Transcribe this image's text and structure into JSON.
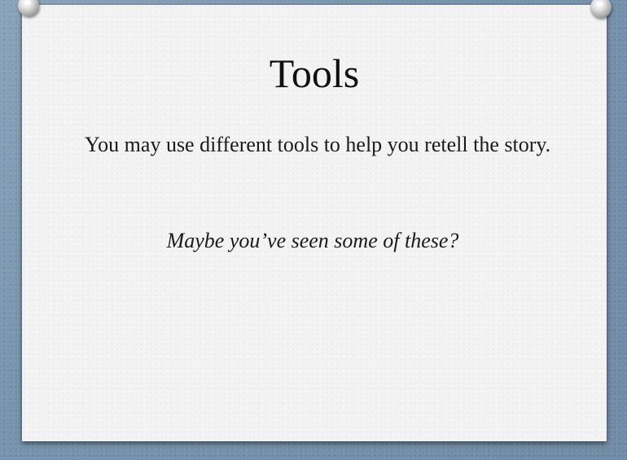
{
  "slide": {
    "title": "Tools",
    "body": "You may use different tools to help you retell the story.",
    "question": "Maybe you’ve seen some of these?"
  },
  "colors": {
    "background": "#7f9ab2",
    "card": "#f3f3f3",
    "text": "#111111"
  },
  "icons": {
    "pin_left": "push-pin-icon",
    "pin_right": "push-pin-icon"
  }
}
